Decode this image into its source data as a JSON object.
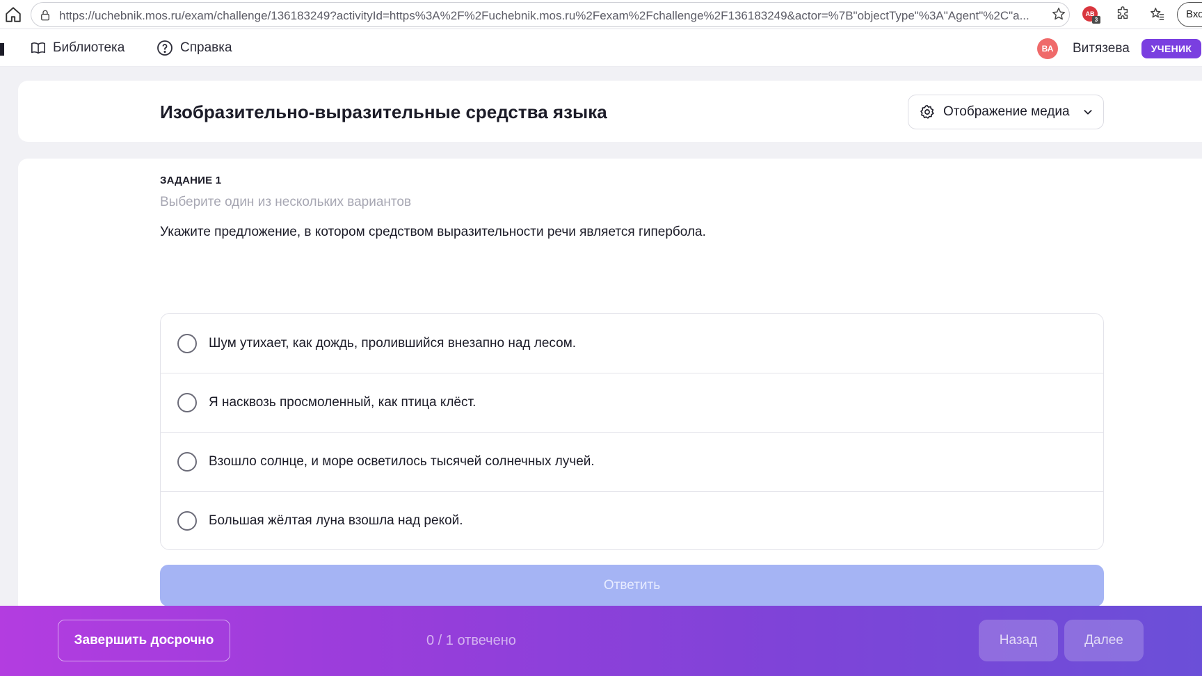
{
  "browser": {
    "url": "https://uchebnik.mos.ru/exam/challenge/136183249?activityId=https%3A%2F%2Fuchebnik.mos.ru%2Fexam%2Fchallenge%2F136183249&actor=%7B\"objectType\"%3A\"Agent\"%2C\"a...",
    "extension_badge": "AB",
    "extension_count": "3",
    "signin_label": "Вхо"
  },
  "header": {
    "nav": [
      {
        "label": "Библиотека",
        "icon": "book-icon"
      },
      {
        "label": "Справка",
        "icon": "help-circle-icon"
      }
    ],
    "avatar_initials": "ВА",
    "username": "Витязева",
    "role": "УЧЕНИК"
  },
  "title_card": {
    "title": "Изобразительно-выразительные средства языка",
    "media_button": "Отображение медиа"
  },
  "task": {
    "number": "ЗАДАНИЕ 1",
    "hint": "Выберите один из нескольких вариантов",
    "question": "Укажите предложение, в котором средством выразительности речи является гипербола.",
    "options": [
      "Шум утихает, как дождь, пролившийся внезапно над лесом.",
      "Я насквозь просмоленный, как птица клёст.",
      "Взошло солнце, и море осветилось тысячей солнечных лучей.",
      "Большая жёлтая луна взошла над рекой."
    ],
    "answer_button": "Ответить"
  },
  "footer": {
    "finish_button": "Завершить досрочно",
    "progress": "0 / 1 отвечено",
    "back_button": "Назад",
    "next_button": "Далее"
  },
  "colors": {
    "accent": "#7a3fe0",
    "answer_button": "#a5b4f4",
    "avatar": "#ef6a6a"
  }
}
